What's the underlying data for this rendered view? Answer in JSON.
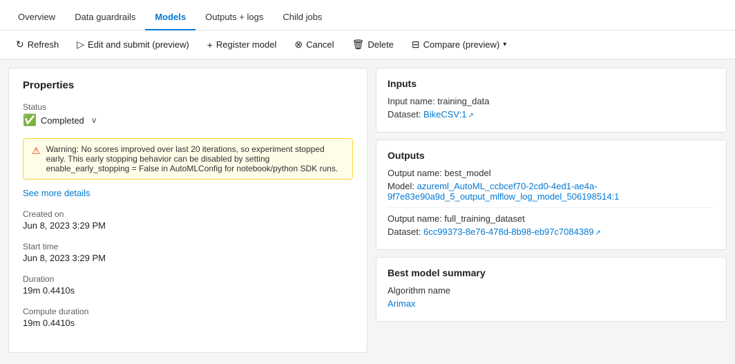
{
  "tabs": [
    {
      "id": "overview",
      "label": "Overview",
      "active": false
    },
    {
      "id": "data-guardrails",
      "label": "Data guardrails",
      "active": false
    },
    {
      "id": "models",
      "label": "Models",
      "active": true
    },
    {
      "id": "outputs-logs",
      "label": "Outputs + logs",
      "active": false
    },
    {
      "id": "child-jobs",
      "label": "Child jobs",
      "active": false
    }
  ],
  "toolbar": {
    "refresh": "Refresh",
    "edit_submit": "Edit and submit (preview)",
    "register_model": "Register model",
    "cancel": "Cancel",
    "delete": "Delete",
    "compare": "Compare (preview)"
  },
  "left_panel": {
    "title": "Properties",
    "status_label": "Status",
    "status_value": "Completed",
    "warning_text": "Warning: No scores improved over last 20 iterations, so experiment stopped early. This early stopping behavior can be disabled by setting enable_early_stopping = False in AutoMLConfig for notebook/python SDK runs.",
    "see_more": "See more details",
    "created_on_label": "Created on",
    "created_on_value": "Jun 8, 2023 3:29 PM",
    "start_time_label": "Start time",
    "start_time_value": "Jun 8, 2023 3:29 PM",
    "duration_label": "Duration",
    "duration_value": "19m 0.4410s",
    "compute_duration_label": "Compute duration",
    "compute_duration_value": "19m 0.4410s"
  },
  "inputs_card": {
    "title": "Inputs",
    "input_name_label": "Input name: training_data",
    "dataset_label": "Dataset:",
    "dataset_link": "BikeCSV:1"
  },
  "outputs_card": {
    "title": "Outputs",
    "output1_name": "Output name: best_model",
    "model_label": "Model:",
    "model_link": "azureml_AutoML_ccbcef70-2cd0-4ed1-ae4a-9f7e83e90a9d_5_output_mlflow_log_model_506198514:1",
    "output2_name": "Output name: full_training_dataset",
    "dataset_label": "Dataset:",
    "dataset_link2": "6cc99373-8e76-478d-8b98-eb97c7084389"
  },
  "best_model_card": {
    "title": "Best model summary",
    "algorithm_name_label": "Algorithm name",
    "algorithm_link": "Arimax"
  }
}
